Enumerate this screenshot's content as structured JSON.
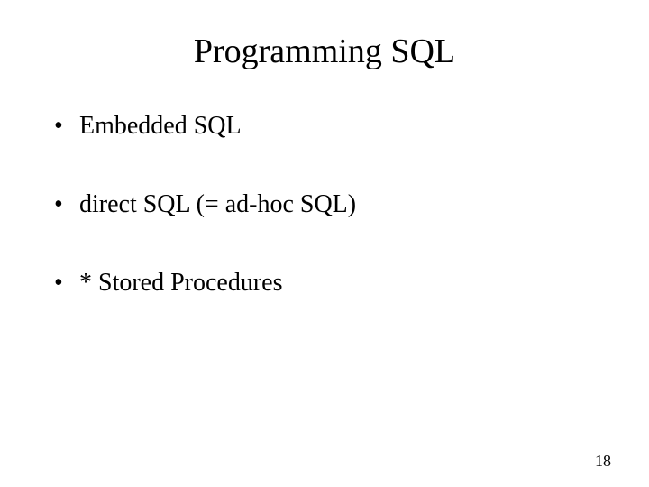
{
  "slide": {
    "title": "Programming SQL",
    "bullets": [
      "Embedded SQL",
      "direct SQL (= ad-hoc SQL)",
      "* Stored Procedures"
    ],
    "page_number": "18"
  }
}
